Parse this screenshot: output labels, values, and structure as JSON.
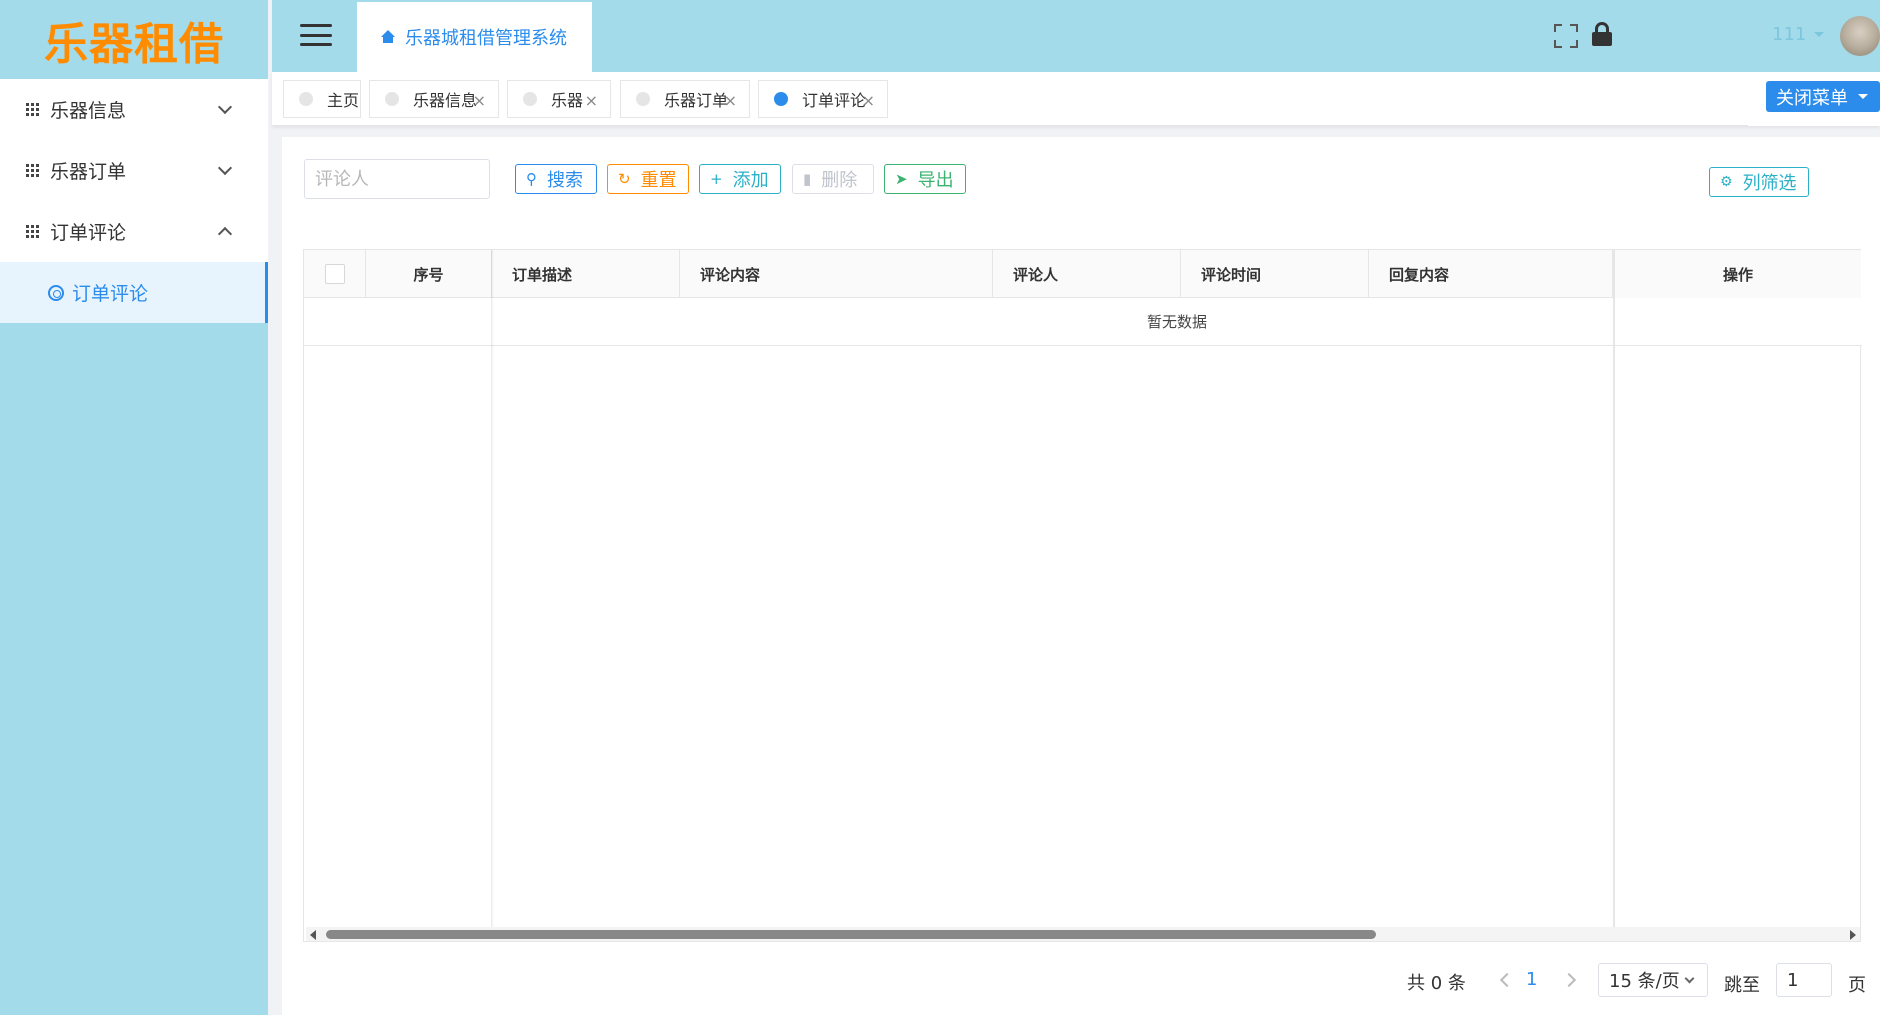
{
  "sidebar": {
    "logo": "乐器租借",
    "items": [
      {
        "label": "乐器信息"
      },
      {
        "label": "乐器订单"
      },
      {
        "label": "订单评论"
      }
    ],
    "sub_item": "订单评论"
  },
  "header": {
    "title_tab": "乐器城租借管理系统",
    "user_name": "111"
  },
  "tags": [
    {
      "label": "主页"
    },
    {
      "label": "乐器信息",
      "close": "×"
    },
    {
      "label": "乐器",
      "close": "×"
    },
    {
      "label": "乐器订单",
      "close": "×"
    },
    {
      "label": "订单评论",
      "close": "×"
    }
  ],
  "close_menu": "关闭菜单",
  "toolbar": {
    "search_placeholder": "评论人",
    "search": "搜索",
    "reset": "重置",
    "add": "添加",
    "delete": "删除",
    "export": "导出",
    "column_filter": "列筛选"
  },
  "table": {
    "columns": [
      "序号",
      "订单描述",
      "评论内容",
      "评论人",
      "评论时间",
      "回复内容",
      "操作"
    ],
    "empty_text": "暂无数据"
  },
  "pager": {
    "total": "共 0 条",
    "page": "1",
    "page_size": "15 条/页",
    "jump_label": "跳至",
    "jump_value": "1",
    "page_suffix": "页"
  },
  "colors": {
    "sidebar_bg": "#a3dbeb",
    "primary": "#2b8ceb",
    "logo": "#ff8c00",
    "reset": "#ff8c00",
    "add": "#2bb0c8",
    "export": "#3cb371"
  }
}
